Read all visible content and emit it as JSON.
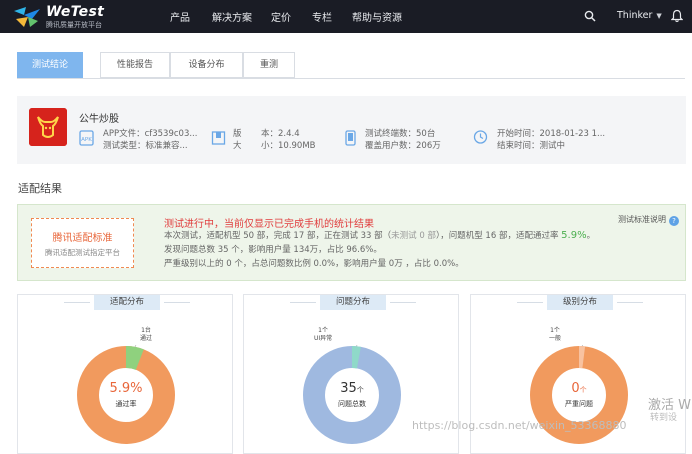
{
  "brand": {
    "name": "WeTest",
    "tagline": "腾讯质量开放平台"
  },
  "nav": {
    "items": [
      "产品",
      "解决方案",
      "定价",
      "专栏",
      "帮助与资源"
    ],
    "user": "Thinker"
  },
  "tabs": [
    "测试结论",
    "性能报告",
    "设备分布",
    "重测"
  ],
  "active_tab": 0,
  "app": {
    "name": "公牛炒股",
    "file_label": "APP文件：cf3539c03...",
    "test_type": "测试类型：标准兼容...",
    "version": "本：2.4.4",
    "version_prefix": "版",
    "size_prefix": "大",
    "size": "小：10.90MB",
    "devices": "测试终端数：50台",
    "users": "覆盖用户数：206万",
    "start_time": "开始时间：2018-01-23 1...",
    "end_time": "结束时间：测试中"
  },
  "section_title": "适配结果",
  "standard": {
    "title": "腾讯适配标准",
    "subtitle": "腾讯适配测试指定平台"
  },
  "result": {
    "headline": "测试进行中，当前仅显示已完成手机的统计结果",
    "line1_prefix": "本次测试，适配机型 50 部，完成 17 部，正在测试 33 部（",
    "line1_muted": "未测试 0 部",
    "line1_mid": "），问题机型 16 部，适配通过率 ",
    "line1_rate": "5.9%",
    "line1_suffix": "。",
    "line2": "发现问题总数 35 个，影响用户量 134万，占比 96.6%。",
    "line3": "严重级别以上的 0 个，占总问题数比例 0.0%，影响用户量 0万 ，占比 0.0%。",
    "doc_link": "测试标准说明"
  },
  "cards": [
    {
      "title": "适配分布",
      "center_value": "5.9%",
      "center_unit": "",
      "center_sub": "通过率",
      "callout_lines": [
        "1台",
        "通过"
      ],
      "main_color": "#f19a5e",
      "accent_color": "#8fd17e",
      "accent_fraction": 0.059
    },
    {
      "title": "问题分布",
      "center_value": "35",
      "center_unit": "个",
      "center_sub": "问题总数",
      "callout_lines": [
        "1个",
        "UI异常"
      ],
      "main_color": "#9fb9e0",
      "accent_color": "#8fd9c9",
      "accent_fraction": 0.029
    },
    {
      "title": "级别分布",
      "center_value": "0",
      "center_unit": "个",
      "center_sub": "严重问题",
      "callout_lines": [
        "1个",
        "一般"
      ],
      "main_color": "#f19a5e",
      "accent_color": "#f8c2a0",
      "accent_fraction": 0.02
    }
  ],
  "overlays": {
    "activate": "激活 W",
    "activate_sub": "转到设",
    "url": "https://blog.csdn.net/weixin_53368880"
  }
}
